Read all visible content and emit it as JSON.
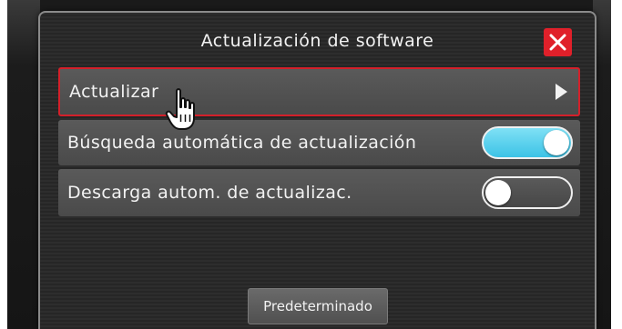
{
  "dialog": {
    "title": "Actualización de software",
    "close_icon": "close-icon"
  },
  "rows": [
    {
      "label": "Actualizar",
      "control": "chevron-right-icon"
    },
    {
      "label": "Búsqueda automática de actualización",
      "control": "toggle",
      "value": true
    },
    {
      "label": "Descarga autom. de actualizac.",
      "control": "toggle",
      "value": false
    }
  ],
  "footer": {
    "default_label": "Predeterminado"
  },
  "colors": {
    "accent_red": "#d4202a",
    "toggle_on": "#3cc3e6",
    "close_bg": "#e0202a"
  },
  "cursor": "hand-pointer-icon"
}
